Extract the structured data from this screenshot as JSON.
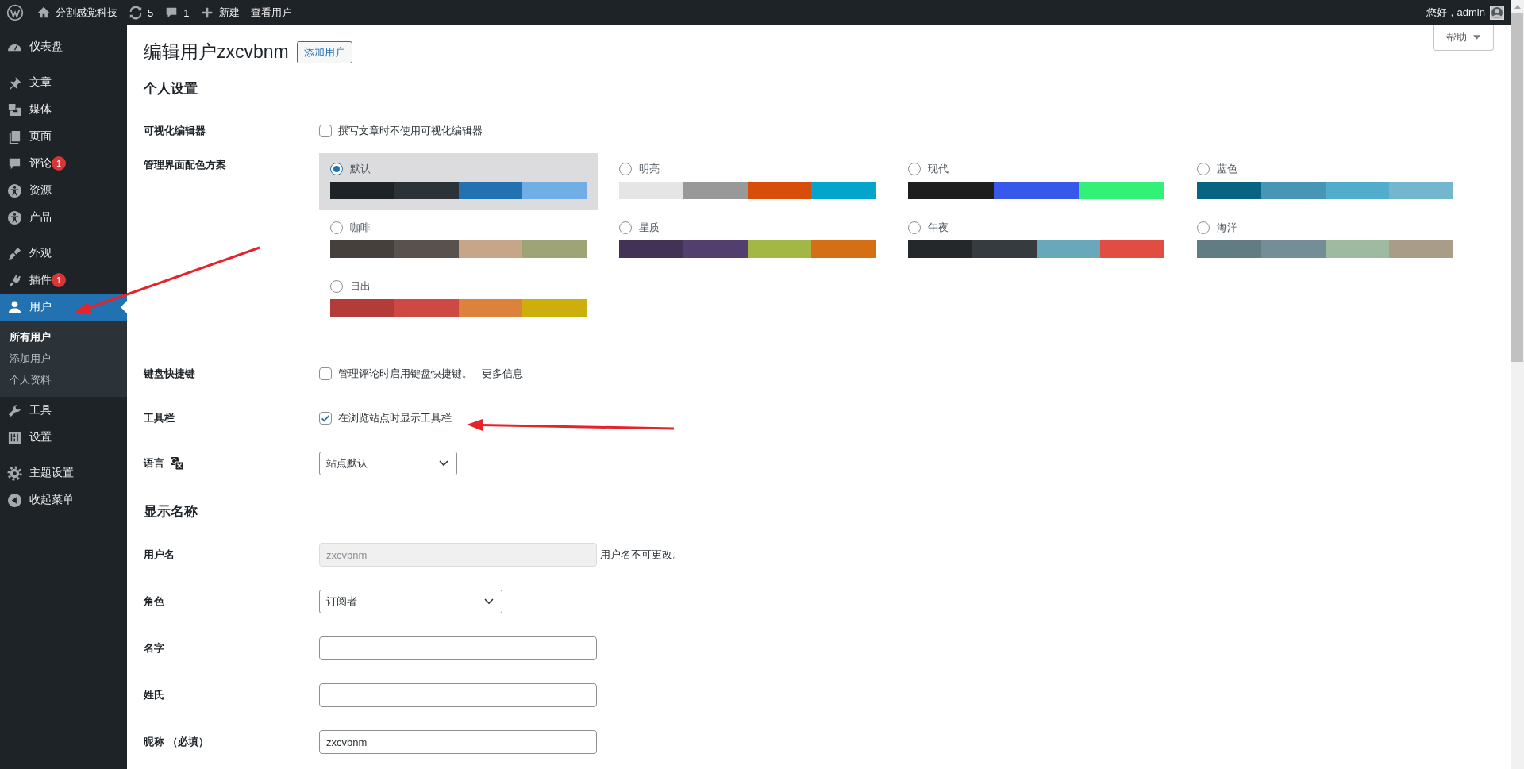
{
  "admin_bar": {
    "site_name": "分割感觉科技",
    "updates_count": "5",
    "comments_count": "1",
    "new_label": "新建",
    "view_label": "查看用户",
    "greeting": "您好，admin"
  },
  "sidebar": {
    "groups": [
      [
        {
          "label": "仪表盘",
          "selected": false
        }
      ],
      [
        {
          "label": "文章",
          "selected": false
        },
        {
          "label": "媒体",
          "selected": false
        },
        {
          "label": "页面",
          "selected": false
        },
        {
          "label": "评论",
          "selected": false,
          "badge": "1"
        },
        {
          "label": "资源",
          "selected": false
        },
        {
          "label": "产品",
          "selected": false
        }
      ],
      [
        {
          "label": "外观",
          "selected": false
        },
        {
          "label": "插件",
          "selected": false,
          "badge": "1"
        },
        {
          "label": "用户",
          "selected": true,
          "children": [
            {
              "label": "所有用户",
              "selected": true
            },
            {
              "label": "添加用户",
              "selected": false
            },
            {
              "label": "个人资料",
              "selected": false
            }
          ]
        },
        {
          "label": "工具",
          "selected": false
        },
        {
          "label": "设置",
          "selected": false
        }
      ],
      [
        {
          "label": "主题设置",
          "selected": false
        },
        {
          "label": "收起菜单",
          "selected": false
        }
      ]
    ]
  },
  "page": {
    "title": "编辑用户zxcvbnm",
    "add_button": "添加用户",
    "help_button": "帮助"
  },
  "sections": [
    {
      "heading": "个人设置",
      "rows": [
        {
          "kind": "checkbox",
          "label": "可视化编辑器",
          "text": "撰写文章时不使用可视化编辑器",
          "checked": false
        },
        {
          "kind": "schemes",
          "label": "管理界面配色方案",
          "schemes": [
            {
              "name": "默认",
              "selected": true,
              "swatches": [
                {
                  "color": "#1d2327"
                },
                {
                  "color": "#2c3338"
                },
                {
                  "color": "#2271b1"
                },
                {
                  "color": "#72aee6"
                }
              ]
            },
            {
              "name": "明亮",
              "selected": false,
              "swatches": [
                {
                  "color": "#e5e5e5"
                },
                {
                  "color": "#999999"
                },
                {
                  "color": "#d64e07"
                },
                {
                  "color": "#04a4cc"
                }
              ]
            },
            {
              "name": "现代",
              "selected": false,
              "swatches": [
                {
                  "color": "#1e1e1e"
                },
                {
                  "color": "#3858e9"
                },
                {
                  "color": "#33f078"
                }
              ]
            },
            {
              "name": "蓝色",
              "selected": false,
              "swatches": [
                {
                  "color": "#096484"
                },
                {
                  "color": "#4796b3"
                },
                {
                  "color": "#52accc"
                },
                {
                  "color": "#74b6ce"
                }
              ]
            },
            {
              "name": "咖啡",
              "selected": false,
              "swatches": [
                {
                  "color": "#46403c"
                },
                {
                  "color": "#59524c"
                },
                {
                  "color": "#c7a589"
                },
                {
                  "color": "#9ea476"
                }
              ]
            },
            {
              "name": "星质",
              "selected": false,
              "swatches": [
                {
                  "color": "#413256"
                },
                {
                  "color": "#523f6d"
                },
                {
                  "color": "#a3b745"
                },
                {
                  "color": "#d46f15"
                }
              ]
            },
            {
              "name": "午夜",
              "selected": false,
              "swatches": [
                {
                  "color": "#25282b"
                },
                {
                  "color": "#363b3f"
                },
                {
                  "color": "#69a8bb"
                },
                {
                  "color": "#e14d43"
                }
              ]
            },
            {
              "name": "海洋",
              "selected": false,
              "swatches": [
                {
                  "color": "#627c83"
                },
                {
                  "color": "#738e96"
                },
                {
                  "color": "#9ebaa0"
                },
                {
                  "color": "#aa9d88"
                }
              ]
            },
            {
              "name": "日出",
              "selected": false,
              "swatches": [
                {
                  "color": "#b43c38"
                },
                {
                  "color": "#cf4944"
                },
                {
                  "color": "#dd823b"
                },
                {
                  "color": "#ccaf0b"
                }
              ]
            }
          ]
        },
        {
          "kind": "checkbox",
          "label": "键盘快捷键",
          "text": "管理评论时启用键盘快捷键。",
          "link": "更多信息",
          "checked": false
        },
        {
          "kind": "checkbox",
          "label": "工具栏",
          "text": "在浏览站点时显示工具栏",
          "checked": true
        },
        {
          "kind": "language",
          "label": "语言",
          "value": "站点默认"
        }
      ]
    },
    {
      "heading": "显示名称",
      "rows": [
        {
          "kind": "text",
          "label": "用户名",
          "value": "zxcvbnm",
          "disabled": true,
          "note": "用户名不可更改。"
        },
        {
          "kind": "select",
          "label": "角色",
          "value": "订阅者"
        },
        {
          "kind": "text",
          "label": "名字",
          "disabled": false
        },
        {
          "kind": "text",
          "label": "姓氏",
          "disabled": false
        },
        {
          "kind": "text",
          "label": "昵称 （必填）",
          "value": "zxcvbnm",
          "disabled": false
        }
      ]
    }
  ]
}
